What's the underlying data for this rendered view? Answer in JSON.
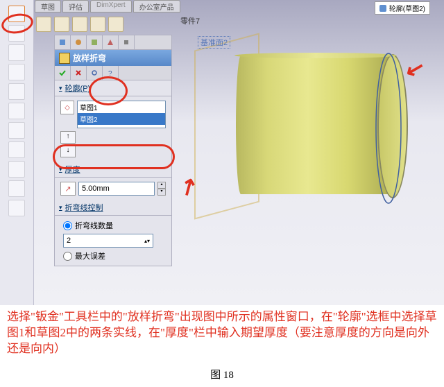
{
  "tabs": [
    "草图",
    "评估",
    "DimXpert",
    "办公室产品"
  ],
  "part_label": "零件7",
  "breadcrumb": "轮廓(草图2)",
  "panel": {
    "title": "放样折弯",
    "profile_label": "轮廓(P)",
    "profiles": [
      "草图1",
      "草图2"
    ],
    "thickness_label": "厚度",
    "thickness_value": "5.00mm",
    "bendline_label": "折弯线控制",
    "bendline_opt1": "折弯线数量",
    "bendline_value": "2",
    "bendline_opt2": "最大误差"
  },
  "viewport": {
    "plane_label": "基准面2"
  },
  "note": "选择\"钣金\"工具栏中的\"放样折弯\"出现图中所示的属性窗口，在\"轮廓\"选框中选择草图1和草图2中的两条实线，在\"厚度\"栏中输入期望厚度（要注意厚度的方向是向外还是向内）",
  "caption": "图 18"
}
